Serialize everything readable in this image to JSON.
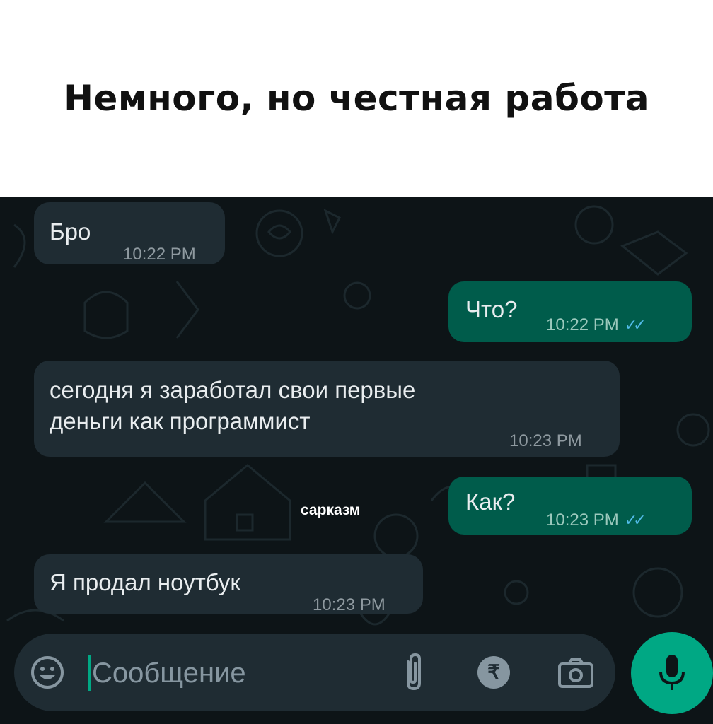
{
  "caption": "Немного, но честная работа",
  "annotation": "сарказм",
  "messages": [
    {
      "direction": "incoming",
      "text": "Бро",
      "time": "10:22 PM"
    },
    {
      "direction": "outgoing",
      "text": "Что?",
      "time": "10:22 PM",
      "ticks": "✓✓",
      "status": "read"
    },
    {
      "direction": "incoming",
      "text_line1": "сегодня я заработал свои первые",
      "text_line2": "деньги как программист",
      "time": "10:23 PM"
    },
    {
      "direction": "outgoing",
      "text": "Как?",
      "time": "10:23 PM",
      "ticks": "✓✓",
      "status": "read"
    },
    {
      "direction": "incoming",
      "text": "Я продал ноутбук",
      "time": "10:23 PM"
    }
  ],
  "composer": {
    "placeholder": "Сообщение",
    "value": "",
    "pay_glyph": "₹",
    "icons": [
      "emoji-icon",
      "paperclip-icon",
      "rupee-icon",
      "camera-icon",
      "microphone-icon"
    ]
  },
  "colors": {
    "chat_background": "#0d1417",
    "incoming_bubble": "#1f2c33",
    "outgoing_bubble": "#005c4b",
    "read_ticks": "#53bdeb",
    "accent": "#00a884"
  }
}
